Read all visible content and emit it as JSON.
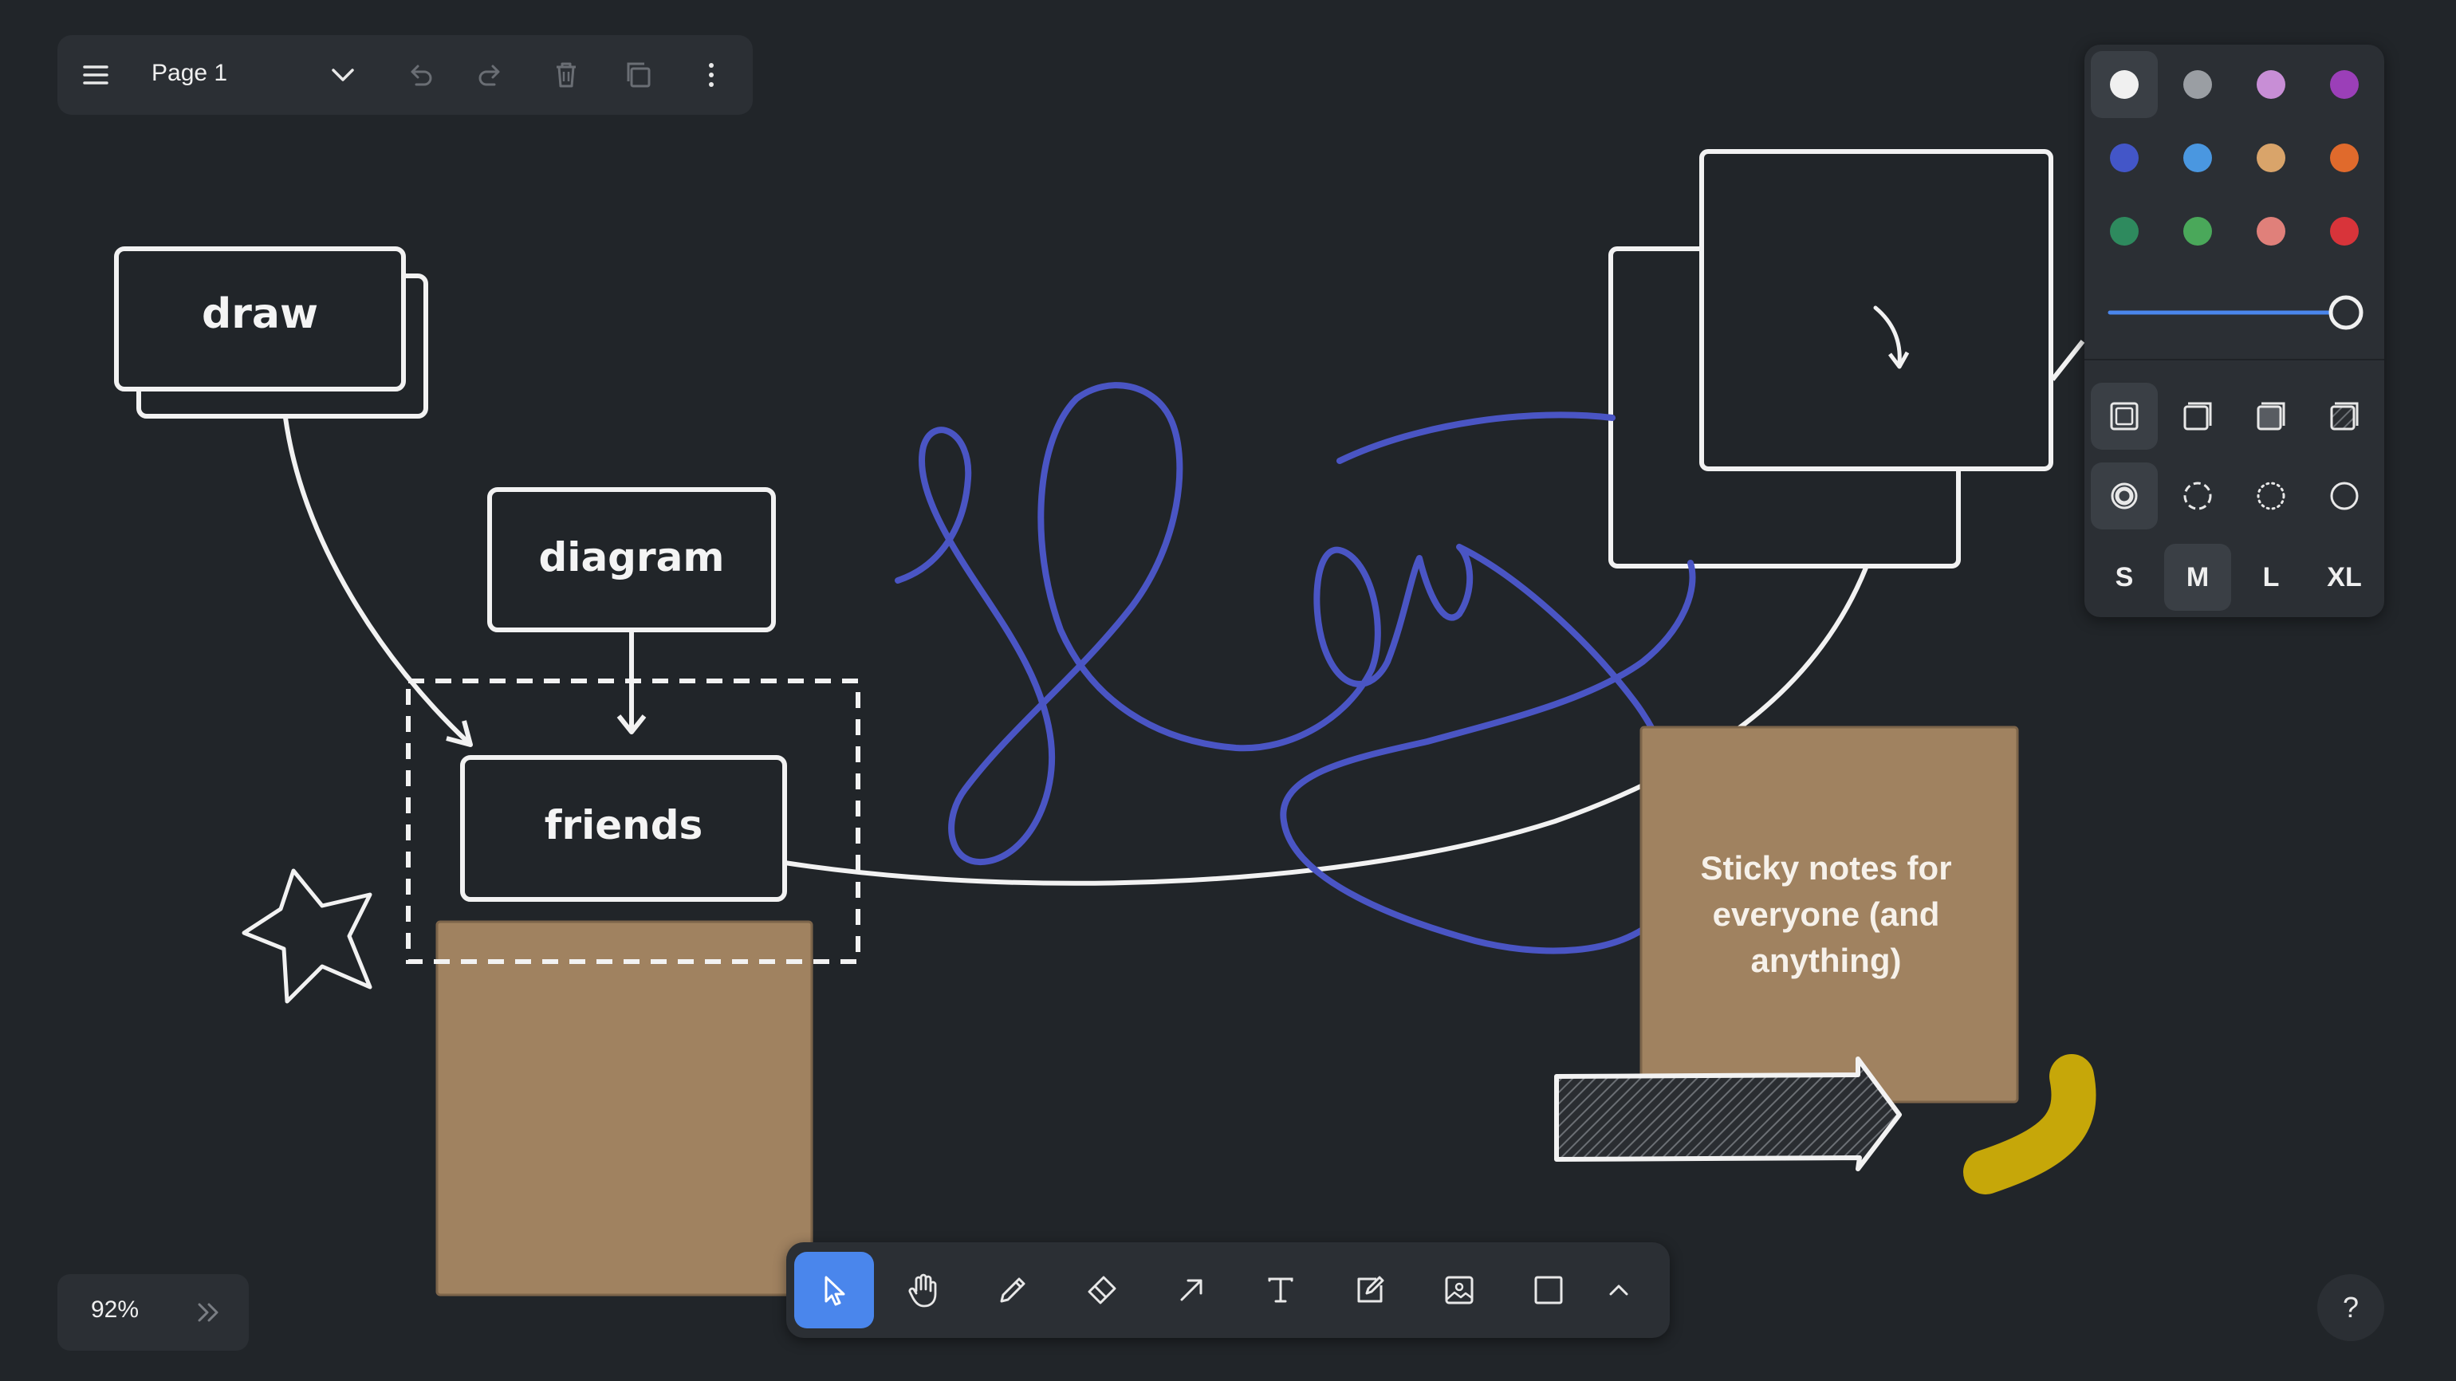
{
  "menu": {
    "page_name": "Page 1",
    "icons": [
      "hamburger-icon",
      "chevron-down-icon",
      "undo-icon",
      "redo-icon",
      "trash-icon",
      "duplicate-icon",
      "more-vertical-icon"
    ]
  },
  "canvas": {
    "labels": {
      "draw": "draw",
      "diagram": "diagram",
      "friends": "friends"
    },
    "sticky_note_text": "Sticky notes for everyone (and anything)",
    "colors": {
      "background": "#212529",
      "stroke_white": "#f2f2f2",
      "scribble_blue": "#4a55c4",
      "sticky_tan": "#a08260",
      "yellow_blob": "#c6a709"
    }
  },
  "style_panel": {
    "colors": [
      {
        "name": "white",
        "hex": "#f0f0f0",
        "selected": true
      },
      {
        "name": "grey",
        "hex": "#9a9ea3",
        "selected": false
      },
      {
        "name": "light-violet",
        "hex": "#c88ed6",
        "selected": false
      },
      {
        "name": "violet",
        "hex": "#9b3fb8",
        "selected": false
      },
      {
        "name": "blue",
        "hex": "#4356c8",
        "selected": false
      },
      {
        "name": "light-blue",
        "hex": "#4a97e0",
        "selected": false
      },
      {
        "name": "yellow",
        "hex": "#d9a46a",
        "selected": false
      },
      {
        "name": "orange",
        "hex": "#e06a2c",
        "selected": false
      },
      {
        "name": "green",
        "hex": "#2e8a5e",
        "selected": false
      },
      {
        "name": "light-green",
        "hex": "#4aa85a",
        "selected": false
      },
      {
        "name": "light-red",
        "hex": "#e0807a",
        "selected": false
      },
      {
        "name": "red",
        "hex": "#d8343a",
        "selected": false
      }
    ],
    "opacity_fraction": 1.0,
    "fill_options": [
      "fill-none-icon",
      "fill-semi-icon",
      "fill-solid-icon",
      "fill-pattern-icon"
    ],
    "dash_options": [
      "dash-draw-icon",
      "dash-dashed-icon",
      "dash-dotted-icon",
      "dash-solid-icon"
    ],
    "sizes": [
      "S",
      "M",
      "L",
      "XL"
    ],
    "selected_size": "M"
  },
  "toolbar": {
    "tools": [
      {
        "name": "select",
        "icon": "pointer-icon",
        "active": true
      },
      {
        "name": "hand",
        "icon": "hand-icon",
        "active": false
      },
      {
        "name": "draw",
        "icon": "pencil-icon",
        "active": false
      },
      {
        "name": "eraser",
        "icon": "eraser-icon",
        "active": false
      },
      {
        "name": "arrow",
        "icon": "arrow-icon",
        "active": false
      },
      {
        "name": "text",
        "icon": "text-icon",
        "active": false
      },
      {
        "name": "note",
        "icon": "note-icon",
        "active": false
      },
      {
        "name": "asset",
        "icon": "image-icon",
        "active": false
      },
      {
        "name": "rectangle",
        "icon": "rectangle-icon",
        "active": false
      },
      {
        "name": "more",
        "icon": "chevron-up-icon",
        "active": false
      }
    ]
  },
  "zoom": {
    "value": "92%"
  },
  "help": {
    "label": "?"
  }
}
